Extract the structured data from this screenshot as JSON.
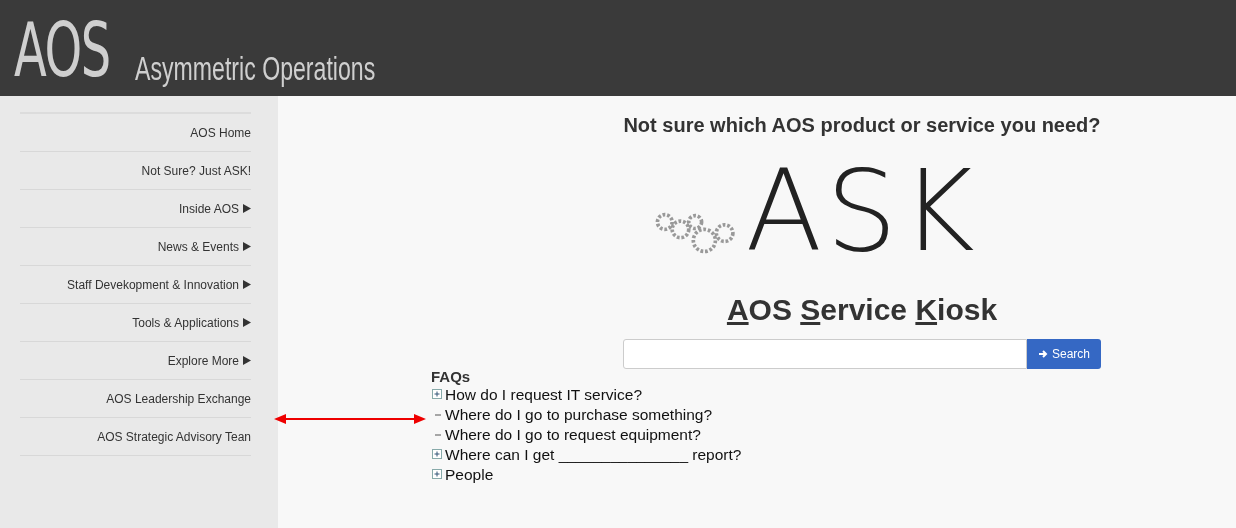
{
  "header": {
    "logo": "AOS",
    "subtitle": "Asymmetric Operations"
  },
  "sidebar": {
    "items": [
      {
        "label": "AOS Home",
        "submenu": false
      },
      {
        "label": "Not Sure? Just ASK!",
        "submenu": false
      },
      {
        "label": "Inside AOS",
        "submenu": true
      },
      {
        "label": "News & Events",
        "submenu": true
      },
      {
        "label": "Staff Devekopment & Innovation",
        "submenu": true
      },
      {
        "label": "Tools & Applications",
        "submenu": true
      },
      {
        "label": "Explore More",
        "submenu": true
      },
      {
        "label": "AOS Leadership Exchange",
        "submenu": false
      },
      {
        "label": "AOS Strategic Advisory Tean",
        "submenu": false
      }
    ]
  },
  "main": {
    "question": "Not sure which AOS product or service you need?",
    "ask_logo": "ASK",
    "kiosk_title": [
      {
        "text": "A",
        "underlined": true
      },
      {
        "text": "OS ",
        "underlined": false
      },
      {
        "text": "S",
        "underlined": true
      },
      {
        "text": "ervice ",
        "underlined": false
      },
      {
        "text": "K",
        "underlined": true
      },
      {
        "text": "iosk",
        "underlined": false
      }
    ],
    "search": {
      "button": "Search"
    },
    "faqs": {
      "title": "FAQs",
      "items": [
        {
          "label": "How do I request IT service?",
          "kind": "expandable"
        },
        {
          "label": "Where do I go to purchase something?",
          "kind": "leaf"
        },
        {
          "label": "Where do I go to request equipment?",
          "kind": "leaf"
        },
        {
          "label": "Where can I get _______________ report?",
          "kind": "expandable"
        },
        {
          "label": "People",
          "kind": "expandable"
        }
      ]
    }
  }
}
